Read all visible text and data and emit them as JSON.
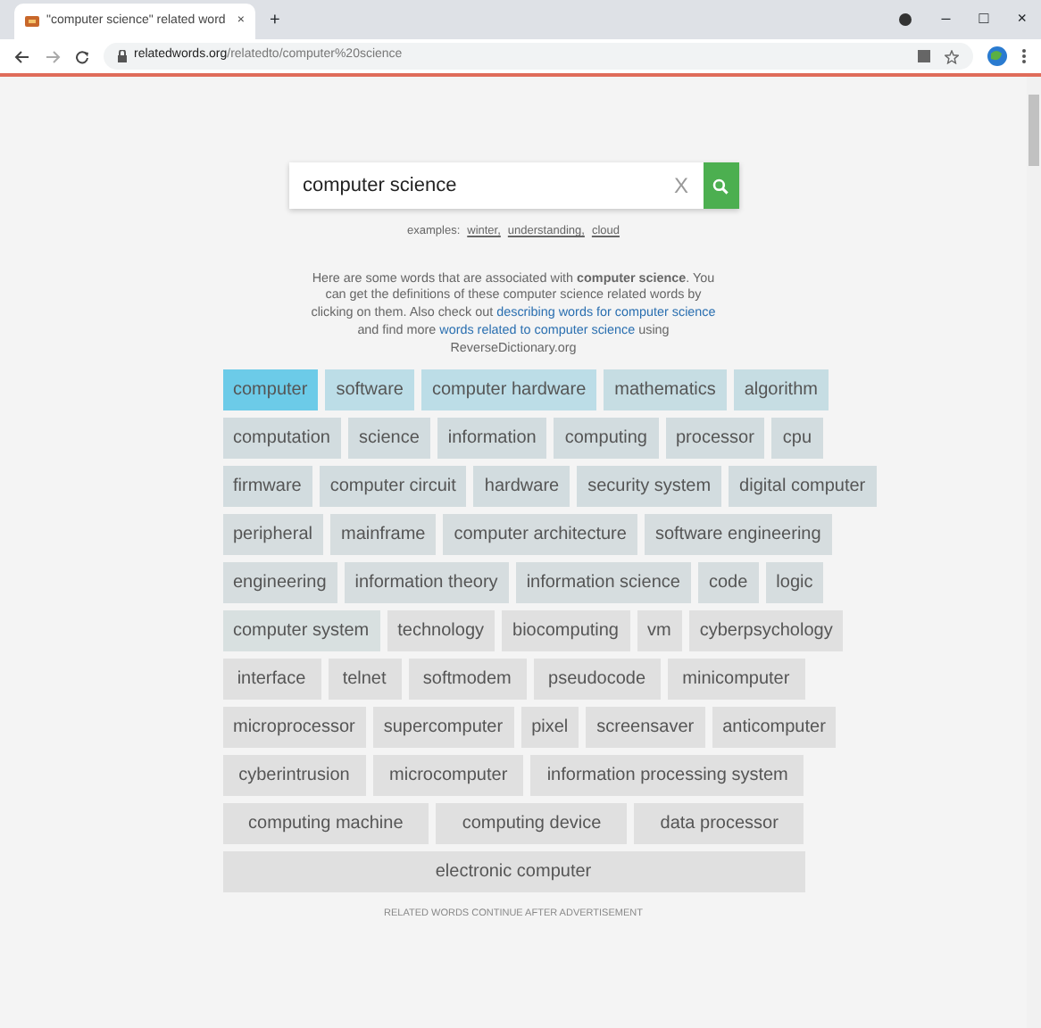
{
  "browser": {
    "tab_title": "\"computer science\" related word",
    "tab_close": "×",
    "new_tab": "+",
    "url_host": "relatedwords.org",
    "url_path": "/relatedto/computer%20science",
    "window_buttons": [
      "–",
      "□",
      "×"
    ]
  },
  "search": {
    "value": "computer science",
    "clear": "X"
  },
  "examples": {
    "label": "examples:",
    "links": [
      "winter,",
      "understanding,",
      "cloud"
    ]
  },
  "intro": "Here are some words that are associated with **computer science**. You can get the definitions of these computer science related words by clicking on them. Also check out ",
  "intro_link1": "describing words for computer science",
  "intro_mid": " and find more ",
  "intro_link2": "words related to computer science",
  "intro_end": " using ReverseDictionary.org",
  "word_rows": [
    [
      {
        "word": "computer",
        "color": "#6ccbe8"
      },
      {
        "word": "software",
        "color": "#bcdde7"
      },
      {
        "word": "computer hardware",
        "color": "#bcdde7"
      },
      {
        "word": "mathematics",
        "color": "#c6dde3"
      },
      {
        "word": "algorithm",
        "color": "#c6dde3"
      }
    ],
    [
      {
        "word": "computation",
        "color": "#d2dcdf"
      },
      {
        "word": "science",
        "color": "#d2dcdf"
      },
      {
        "word": "information",
        "color": "#d2dcdf"
      },
      {
        "word": "computing",
        "color": "#d2dcdf"
      },
      {
        "word": "processor",
        "color": "#d2dcdf"
      },
      {
        "word": "cpu",
        "color": "#d2dcdf"
      }
    ],
    [
      {
        "word": "firmware",
        "color": "#d2dcdf"
      },
      {
        "word": "computer circuit",
        "color": "#d2dcdf"
      },
      {
        "word": "hardware",
        "color": "#d2dcdf"
      },
      {
        "word": "security system",
        "color": "#d2dcdf"
      },
      {
        "word": "digital computer",
        "color": "#d2dcdf"
      }
    ],
    [
      {
        "word": "peripheral",
        "color": "#d6dddf"
      },
      {
        "word": "mainframe",
        "color": "#d6dddf"
      },
      {
        "word": "computer architecture",
        "color": "#d6dddf"
      },
      {
        "word": "software engineering",
        "color": "#d6dddf"
      }
    ],
    [
      {
        "word": "engineering",
        "color": "#d6dddf"
      },
      {
        "word": "information theory",
        "color": "#d6dddf"
      },
      {
        "word": "information science",
        "color": "#d6dddf"
      },
      {
        "word": "code",
        "color": "#d6dddf"
      },
      {
        "word": "logic",
        "color": "#d6dddf"
      }
    ],
    [
      {
        "word": "computer system",
        "color": "#d8e0e0"
      },
      {
        "word": "technology",
        "color": "#e0e0e0"
      },
      {
        "word": "biocomputing",
        "color": "#e0e0e0"
      },
      {
        "word": "vm",
        "color": "#e0e0e0"
      },
      {
        "word": "cyberpsychology",
        "color": "#e0e0e0"
      }
    ],
    [
      {
        "word": "interface",
        "color": "#e0e0e0"
      },
      {
        "word": "telnet",
        "color": "#e0e0e0"
      },
      {
        "word": "softmodem",
        "color": "#e0e0e0"
      },
      {
        "word": "pseudocode",
        "color": "#e0e0e0"
      },
      {
        "word": "minicomputer",
        "color": "#e0e0e0"
      }
    ],
    [
      {
        "word": "microprocessor",
        "color": "#e0e0e0"
      },
      {
        "word": "supercomputer",
        "color": "#e0e0e0"
      },
      {
        "word": "pixel",
        "color": "#e0e0e0"
      },
      {
        "word": "screensaver",
        "color": "#e0e0e0"
      },
      {
        "word": "anticomputer",
        "color": "#e0e0e0"
      }
    ],
    [
      {
        "word": "cyberintrusion",
        "color": "#e0e0e0"
      },
      {
        "word": "microcomputer",
        "color": "#e0e0e0"
      },
      {
        "word": "information processing system",
        "color": "#e0e0e0"
      }
    ],
    [
      {
        "word": "computing machine",
        "color": "#e0e0e0"
      },
      {
        "word": "computing device",
        "color": "#e0e0e0"
      },
      {
        "word": "data processor",
        "color": "#e0e0e0"
      }
    ],
    [
      {
        "word": "electronic computer",
        "color": "#e0e0e0"
      }
    ]
  ],
  "ad_note": "RELATED WORDS CONTINUE AFTER ADVERTISEMENT"
}
